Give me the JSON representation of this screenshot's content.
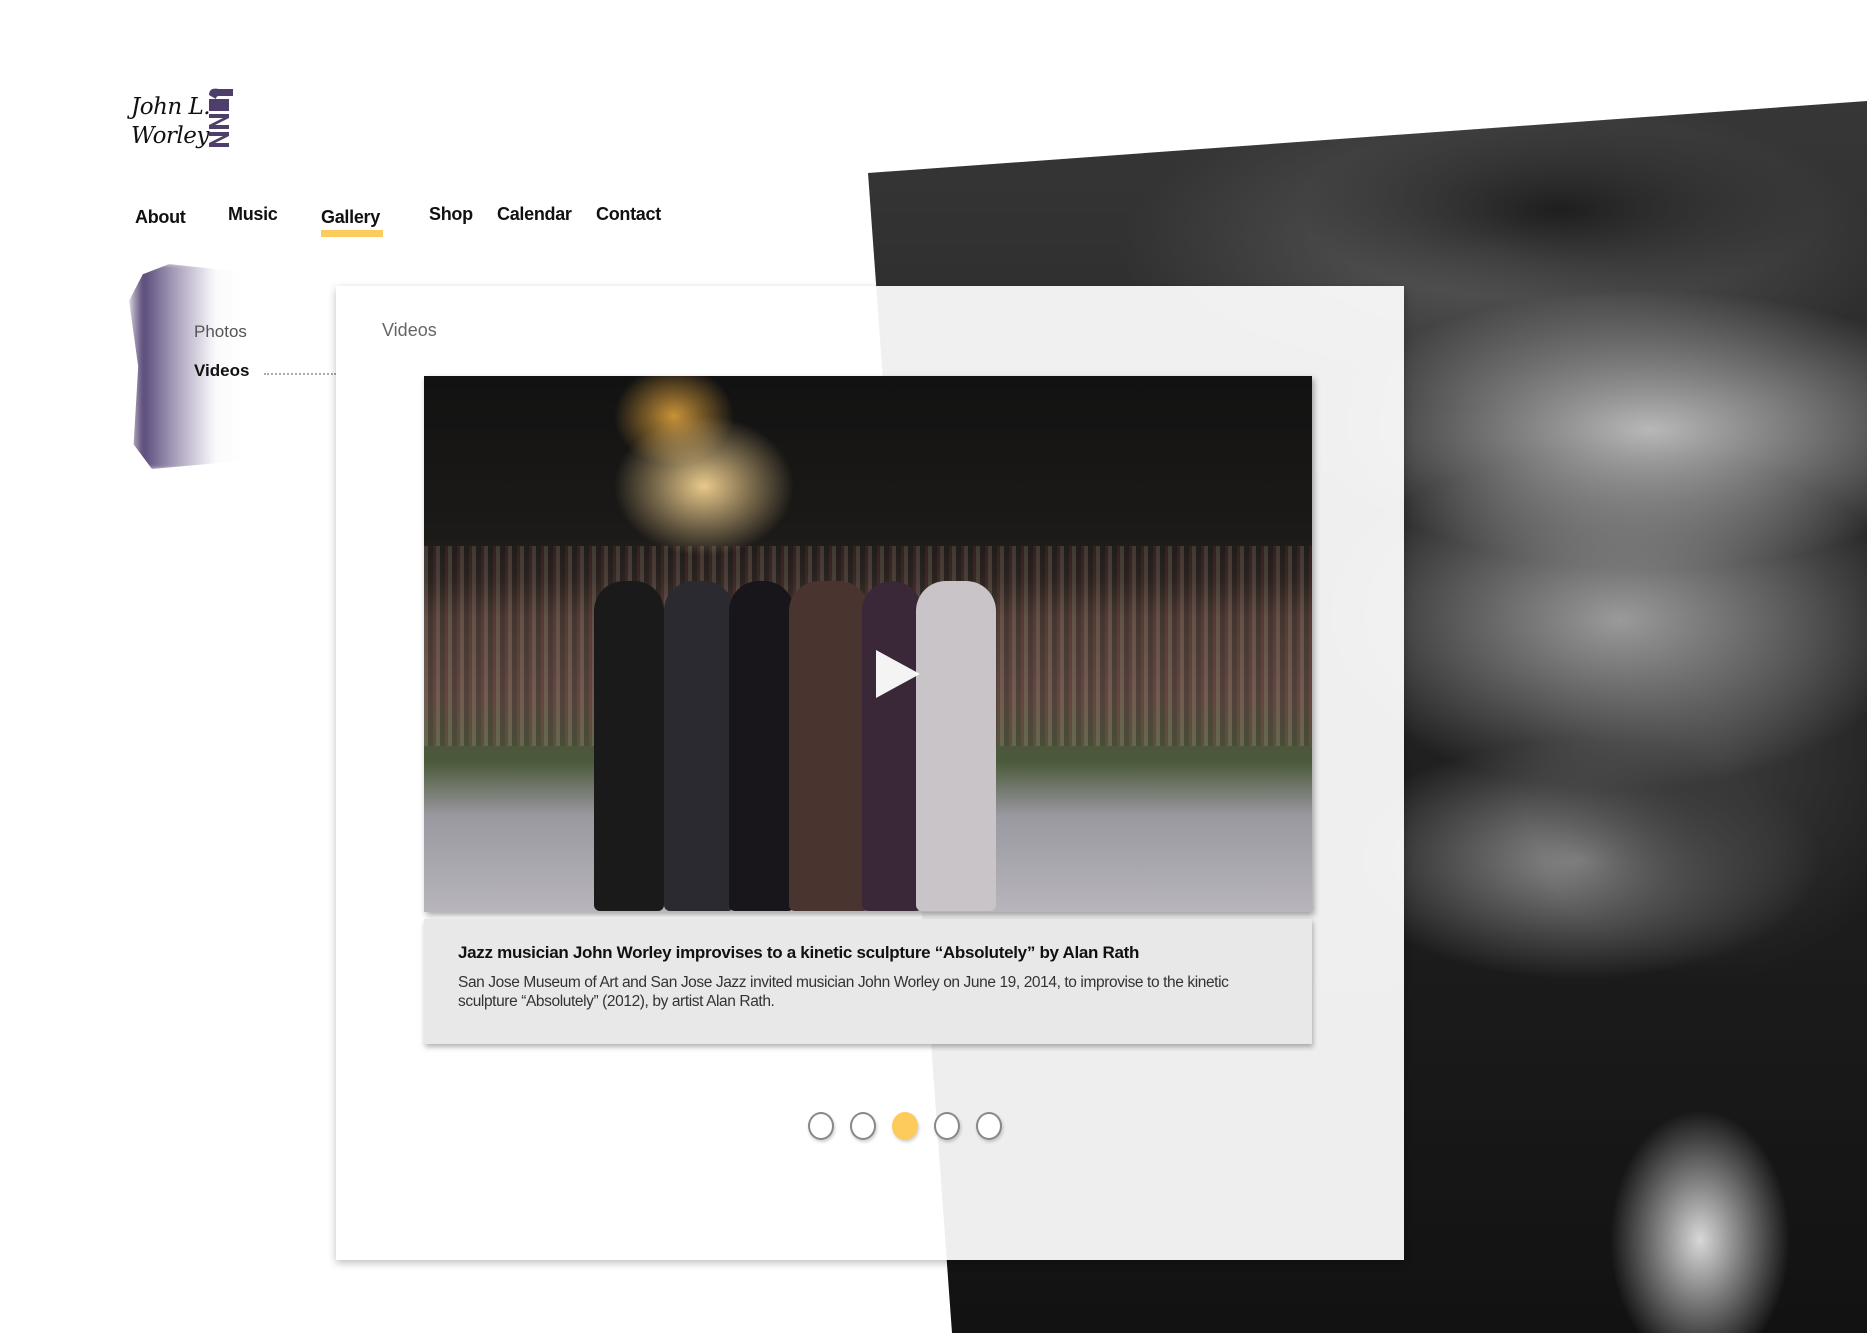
{
  "logo": {
    "line1": "John L.",
    "line2": "Worley",
    "mark": "JAZZ",
    "mark_color": "#4e3e6a"
  },
  "nav": {
    "items": [
      {
        "label": "About"
      },
      {
        "label": "Music"
      },
      {
        "label": "Gallery",
        "active": true
      },
      {
        "label": "Shop"
      },
      {
        "label": "Calendar"
      },
      {
        "label": "Contact"
      }
    ],
    "accent": "#fdcb5c"
  },
  "subnav": {
    "items": [
      {
        "label": "Photos"
      },
      {
        "label": "Videos",
        "active": true
      }
    ]
  },
  "panel": {
    "title": "Videos"
  },
  "video": {
    "icon": "play-icon",
    "title": "Jazz musician John Worley improvises to a kinetic sculpture “Absolutely” by Alan Rath",
    "description": "San Jose Museum of Art and San Jose Jazz invited musician John Worley on June 19, 2014, to improvise to the kinetic sculpture “Absolutely” (2012), by artist Alan Rath."
  },
  "pager": {
    "count": 5,
    "active_index": 2
  }
}
